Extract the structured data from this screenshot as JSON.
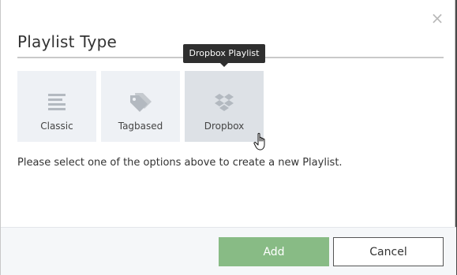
{
  "dialog": {
    "title": "Playlist Type",
    "close_glyph": "×",
    "hint": "Please select one of the options above to create a new Playlist."
  },
  "options": [
    {
      "label": "Classic",
      "icon": "list-lines-icon"
    },
    {
      "label": "Tagbased",
      "icon": "tags-icon"
    },
    {
      "label": "Dropbox",
      "icon": "dropbox-icon",
      "state": "hover"
    }
  ],
  "tooltip": {
    "text": "Dropbox Playlist"
  },
  "footer": {
    "add_label": "Add",
    "cancel_label": "Cancel"
  },
  "colors": {
    "add_button": "#88bb85",
    "tile": "#eef1f5",
    "tile_hover": "#dde1e6",
    "icon": "#b3b9c0",
    "tooltip_bg": "#2f2f2f"
  }
}
